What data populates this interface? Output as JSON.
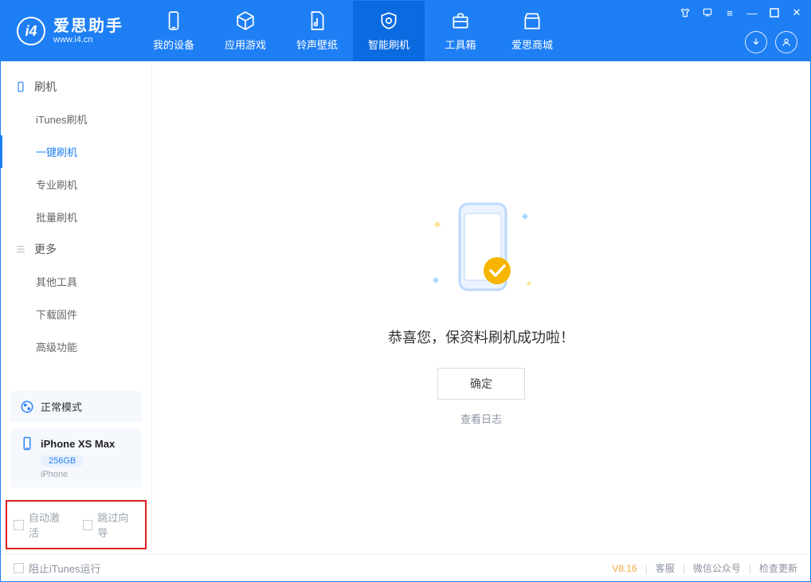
{
  "brand": {
    "name": "爱思助手",
    "site": "www.i4.cn",
    "logo_letter": "i4"
  },
  "tabs": [
    {
      "label": "我的设备"
    },
    {
      "label": "应用游戏"
    },
    {
      "label": "铃声壁纸"
    },
    {
      "label": "智能刷机"
    },
    {
      "label": "工具箱"
    },
    {
      "label": "爱思商城"
    }
  ],
  "sidebar": {
    "sections": [
      {
        "title": "刷机",
        "items": [
          {
            "label": "iTunes刷机"
          },
          {
            "label": "一键刷机"
          },
          {
            "label": "专业刷机"
          },
          {
            "label": "批量刷机"
          }
        ]
      },
      {
        "title": "更多",
        "items": [
          {
            "label": "其他工具"
          },
          {
            "label": "下载固件"
          },
          {
            "label": "高级功能"
          }
        ]
      }
    ],
    "mode_label": "正常模式",
    "device": {
      "name": "iPhone XS Max",
      "storage": "256GB",
      "type": "iPhone"
    }
  },
  "checks": {
    "auto_activate": "自动激活",
    "skip_guide": "跳过向导"
  },
  "main": {
    "title": "恭喜您，保资料刷机成功啦！",
    "ok": "确定",
    "view_log": "查看日志"
  },
  "footer": {
    "block_itunes": "阻止iTunes运行",
    "version": "V8.16",
    "support": "客服",
    "wechat": "微信公众号",
    "check_update": "检查更新"
  }
}
